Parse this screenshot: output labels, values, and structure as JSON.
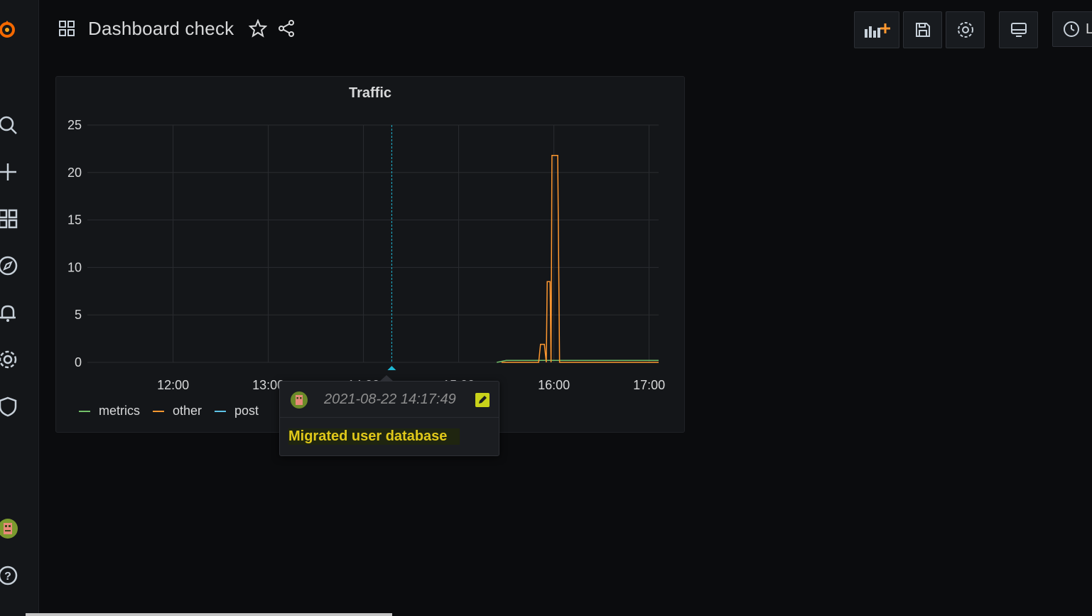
{
  "dashboard": {
    "title": "Dashboard check"
  },
  "toolbar": {
    "add_panel": "add-panel-icon",
    "save": "save-icon",
    "settings": "settings-icon",
    "tv_mode": "monitor-icon",
    "time_picker_label": "L"
  },
  "sidebar": {
    "items": [
      "grafana-logo",
      "search-icon",
      "plus-icon",
      "dashboards-icon",
      "explore-icon",
      "alert-bell-icon",
      "gear-icon",
      "shield-icon",
      "avatar",
      "help-icon"
    ]
  },
  "panel": {
    "title": "Traffic",
    "legend": [
      {
        "label": "metrics",
        "color": "#73bf69"
      },
      {
        "label": "other",
        "color": "#ff9830"
      },
      {
        "label": "post",
        "color": "#5794f2"
      }
    ]
  },
  "tooltip": {
    "time": "2021-08-22 14:17:49",
    "text": "Migrated user database"
  },
  "chart_data": {
    "type": "line",
    "title": "Traffic",
    "xlabel": "",
    "ylabel": "",
    "x_ticks": [
      "12:00",
      "13:00",
      "14:00",
      "15:00",
      "16:00",
      "17:00"
    ],
    "y_ticks": [
      0,
      5,
      10,
      15,
      20,
      25
    ],
    "ylim": [
      0,
      25
    ],
    "grid": true,
    "legend_position": "bottom-left",
    "annotation": {
      "time": "14:17:49",
      "text": "Migrated user database"
    },
    "series": [
      {
        "name": "metrics",
        "color": "#73bf69",
        "points": [
          [
            15.4,
            0
          ],
          [
            15.5,
            0.2
          ],
          [
            15.7,
            0.2
          ],
          [
            15.8,
            0.2
          ],
          [
            16.0,
            0.2
          ],
          [
            17.1,
            0.2
          ]
        ]
      },
      {
        "name": "other",
        "color": "#ff9830",
        "points": [
          [
            15.45,
            0
          ],
          [
            15.6,
            0
          ],
          [
            15.84,
            0
          ],
          [
            15.86,
            1.9
          ],
          [
            15.9,
            1.9
          ],
          [
            15.92,
            0
          ],
          [
            15.93,
            8.5
          ],
          [
            15.96,
            8.5
          ],
          [
            15.97,
            0
          ],
          [
            15.98,
            21.8
          ],
          [
            16.04,
            21.8
          ],
          [
            16.06,
            0
          ],
          [
            17.1,
            0
          ]
        ]
      },
      {
        "name": "post",
        "color": "#5794f2",
        "points": []
      }
    ]
  }
}
